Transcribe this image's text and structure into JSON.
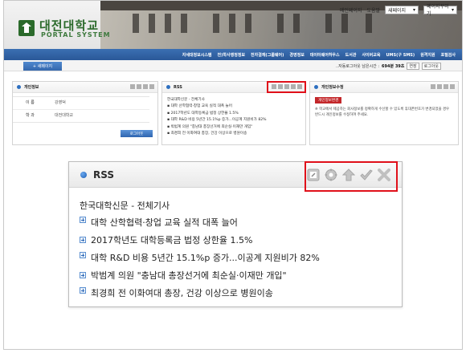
{
  "header": {
    "logo_title": "대전대학교",
    "logo_sub": "PORTAL SYSTEM",
    "toplinks": [
      "메인페이지",
      "도움말"
    ],
    "select1": "새페이지",
    "select2": "페이지꾸미기"
  },
  "nav": {
    "items": [
      "자세대정보시스템",
      "전)학사행정정보",
      "전자결재(그룹웨어)",
      "경영정보",
      "데이터웨어하우스",
      "도서관",
      "사이버교육",
      "UMS(구 SMS)",
      "원격지원",
      "포털검사"
    ]
  },
  "subbar": {
    "tab": "+ 새페이지",
    "session_prefix": "..자동로그아웃 남은시간 :",
    "session_time": "694분 39초",
    "extend": "연장",
    "logout": "로그아웃"
  },
  "personal": {
    "title": "개인정보",
    "name_label": "이 름",
    "name_value": "강영덕",
    "dept_label": "학 과",
    "dept_value": "대전대학교",
    "logout_btn": "로그아웃"
  },
  "rss_small": {
    "title": "RSS",
    "source": "한국대학신문 - 전체기사",
    "items": [
      "대학 산학협력·창업 교육 실적 대폭 늘어",
      "2017학년도 대학등록금 법정 상한율 1.5%",
      "대학 R&D 비용 5년간 15.1%p 증가...이공계 지원비가 82%",
      "박범계 의원 \"충남대 총장선거에 최순실·이재만 개입\"",
      "최경희 전 이화여대 총장, 건강 이상으로 병원이송"
    ]
  },
  "modify": {
    "title": "개인정보수정",
    "btn": "개인정보변경",
    "desc": "※ 학교에서 제공하는 회사정보를 정확하게 수신할 수 있도록 휴대폰번호가 변경되었을 경우 반드시 개인정보를 수정하여 주세요."
  },
  "rss_big": {
    "title": "RSS",
    "source": "한국대학신문 - 전체기사",
    "items": [
      "대학 산학협력·창업 교육 실적 대폭 늘어",
      "2017학년도 대학등록금 법정 상한율 1.5%",
      "대학 R&D 비용 5년간 15.1%p 증가...이공계 지원비가 82%",
      "박범계 의원 \"충남대 총장선거에 최순실·이재만 개입\"",
      "최경희 전 이화여대 총장, 건강 이상으로 병원이송"
    ],
    "icons": [
      "edit-icon",
      "gear-icon",
      "up-arrow-icon",
      "check-icon",
      "close-icon"
    ]
  },
  "colors": {
    "nav": "#2a5898",
    "highlight": "#e0101a",
    "logo": "#2b6a2b"
  }
}
